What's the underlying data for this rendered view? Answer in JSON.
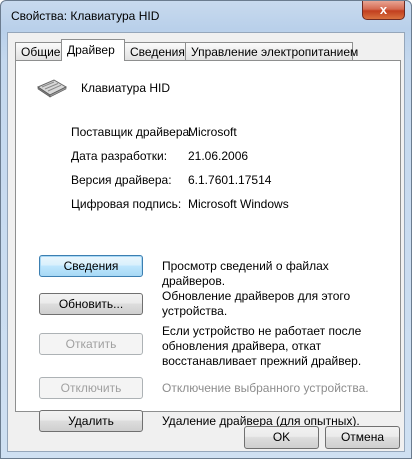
{
  "window": {
    "title": "Свойства: Клавиатура HID",
    "close_glyph": "x"
  },
  "tabs": [
    {
      "label": "Общие"
    },
    {
      "label": "Драйвер",
      "active": true
    },
    {
      "label": "Сведения"
    },
    {
      "label": "Управление электропитанием"
    }
  ],
  "device": {
    "name": "Клавиатура HID",
    "icon": "keyboard-icon"
  },
  "properties": [
    {
      "label": "Поставщик драйвера:",
      "value": "Microsoft"
    },
    {
      "label": "Дата разработки:",
      "value": "21.06.2006"
    },
    {
      "label": "Версия драйвера:",
      "value": "6.1.7601.17514"
    },
    {
      "label": "Цифровая подпись:",
      "value": "Microsoft Windows"
    }
  ],
  "actions": [
    {
      "label": "Сведения",
      "description": "Просмотр сведений о файлах драйверов.",
      "enabled": true
    },
    {
      "label": "Обновить...",
      "description": "Обновление драйверов для этого устройства.",
      "enabled": true
    },
    {
      "label": "Откатить",
      "description": "Если устройство не работает после обновления драйвера, откат восстанавливает прежний драйвер.",
      "enabled": false
    },
    {
      "label": "Отключить",
      "description": "Отключение выбранного устройства.",
      "enabled": false
    },
    {
      "label": "Удалить",
      "description": "Удаление драйвера (для опытных).",
      "enabled": true
    }
  ],
  "footer": {
    "ok_label": "OK",
    "cancel_label": "Отмена"
  }
}
